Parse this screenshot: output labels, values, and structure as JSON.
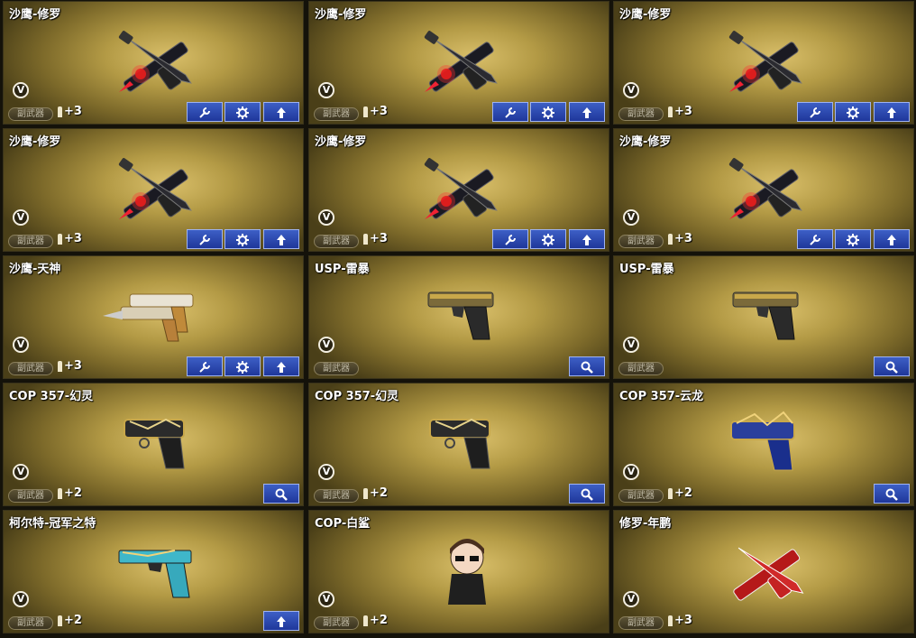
{
  "tag_label": "副武器",
  "badge_letter": "V",
  "cards": [
    {
      "name": "沙鹰-修罗",
      "plus": "+3",
      "art": "xcross",
      "buttons": [
        "wrench",
        "gear",
        "up"
      ]
    },
    {
      "name": "沙鹰-修罗",
      "plus": "+3",
      "art": "xcross",
      "buttons": [
        "wrench",
        "gear",
        "up"
      ]
    },
    {
      "name": "沙鹰-修罗",
      "plus": "+3",
      "art": "xcross",
      "buttons": [
        "wrench",
        "gear",
        "up"
      ]
    },
    {
      "name": "沙鹰-修罗",
      "plus": "+3",
      "art": "xcross",
      "buttons": [
        "wrench",
        "gear",
        "up"
      ]
    },
    {
      "name": "沙鹰-修罗",
      "plus": "+3",
      "art": "xcross",
      "buttons": [
        "wrench",
        "gear",
        "up"
      ]
    },
    {
      "name": "沙鹰-修罗",
      "plus": "+3",
      "art": "xcross",
      "buttons": [
        "wrench",
        "gear",
        "up"
      ]
    },
    {
      "name": "沙鹰-天神",
      "plus": "+3",
      "art": "dual-gold",
      "buttons": [
        "wrench",
        "gear",
        "up"
      ]
    },
    {
      "name": "USP-雷暴",
      "plus": "",
      "art": "usp",
      "buttons": [
        "search"
      ]
    },
    {
      "name": "USP-雷暴",
      "plus": "",
      "art": "usp",
      "buttons": [
        "search"
      ]
    },
    {
      "name": "COP 357-幻灵",
      "plus": "+2",
      "art": "cop-dark",
      "buttons": [
        "search"
      ]
    },
    {
      "name": "COP 357-幻灵",
      "plus": "+2",
      "art": "cop-dark",
      "buttons": [
        "search"
      ]
    },
    {
      "name": "COP 357-云龙",
      "plus": "+2",
      "art": "cop-blue",
      "buttons": [
        "search"
      ]
    },
    {
      "name": "柯尔特-冠军之特",
      "plus": "+2",
      "art": "colt",
      "buttons": [
        "up"
      ]
    },
    {
      "name": "COP-白鲨",
      "plus": "+2",
      "art": "figure",
      "buttons": []
    },
    {
      "name": "修罗-年鹏",
      "plus": "+3",
      "art": "xcross-red",
      "buttons": []
    }
  ]
}
